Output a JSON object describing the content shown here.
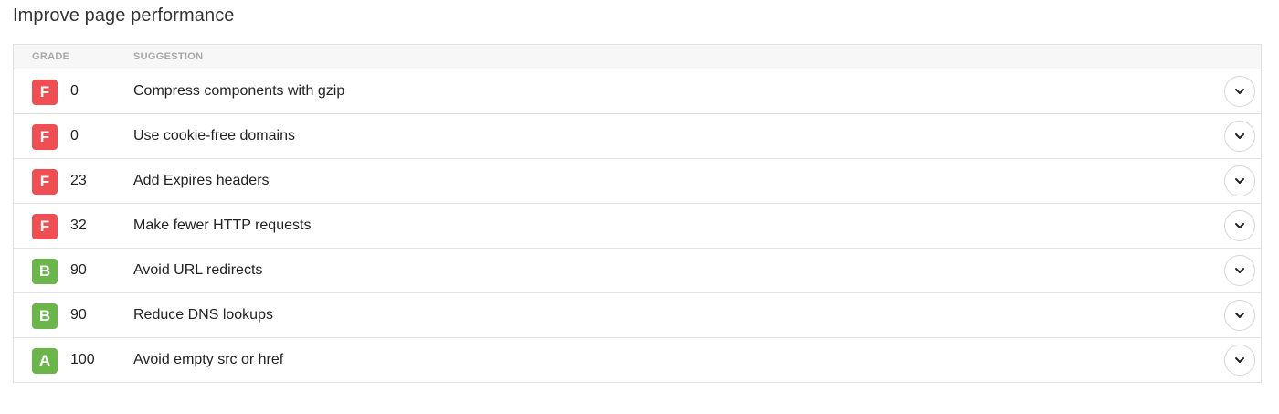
{
  "page": {
    "title": "Improve page performance"
  },
  "table": {
    "headers": {
      "grade": "GRADE",
      "suggestion": "SUGGESTION"
    },
    "rows": [
      {
        "grade": "F",
        "score": "0",
        "suggestion": "Compress components with gzip",
        "color": "#ef4f53"
      },
      {
        "grade": "F",
        "score": "0",
        "suggestion": "Use cookie-free domains",
        "color": "#ef4f53"
      },
      {
        "grade": "F",
        "score": "23",
        "suggestion": "Add Expires headers",
        "color": "#ef4f53"
      },
      {
        "grade": "F",
        "score": "32",
        "suggestion": "Make fewer HTTP requests",
        "color": "#ef4f53"
      },
      {
        "grade": "B",
        "score": "90",
        "suggestion": "Avoid URL redirects",
        "color": "#6ab64a"
      },
      {
        "grade": "B",
        "score": "90",
        "suggestion": "Reduce DNS lookups",
        "color": "#6ab64a"
      },
      {
        "grade": "A",
        "score": "100",
        "suggestion": "Avoid empty src or href",
        "color": "#6ab64a"
      }
    ],
    "expand_icon": "chevron-down-icon"
  }
}
